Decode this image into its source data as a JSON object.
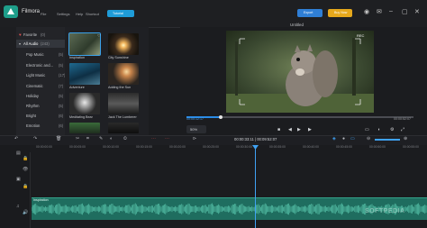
{
  "app": {
    "name": "Filmora"
  },
  "menu": [
    "File",
    "Settings",
    "Help",
    "Shortcut"
  ],
  "toolbar": {
    "tutorial": "Tutorial",
    "export": "Export",
    "buy_now": "Buy Now"
  },
  "library": {
    "items": [
      {
        "label": "Favorite",
        "count": "(0)"
      },
      {
        "label": "All Audio",
        "count": "(243)"
      },
      {
        "label": "Pop Music",
        "count": "(5)"
      },
      {
        "label": "Electronic and...",
        "count": "(5)"
      },
      {
        "label": "Light Music",
        "count": "(17)"
      },
      {
        "label": "Cinematic",
        "count": "(7)"
      },
      {
        "label": "Holiday",
        "count": "(5)"
      },
      {
        "label": "Rhythm",
        "count": "(5)"
      },
      {
        "label": "Bright",
        "count": "(6)"
      },
      {
        "label": "Emotion",
        "count": "(6)"
      }
    ],
    "selected": "All Audio"
  },
  "media": [
    {
      "label": "Inspiration"
    },
    {
      "label": "City Sunshine"
    },
    {
      "label": "Adventure"
    },
    {
      "label": "Adding the Sun"
    },
    {
      "label": "Meditating Bear"
    },
    {
      "label": "Jack The Lumberer"
    }
  ],
  "preview": {
    "title": "Untitled",
    "time_current": "00:00:12:17",
    "time_total": "00:00:52:07",
    "zoom": "50%",
    "progress": 0.15
  },
  "timeline": {
    "timecode": "00:00:33:11 | 00:09:52:07",
    "ruler": [
      "00:00:00:00",
      "00:00:05:00",
      "00:00:10:00",
      "00:00:15:00",
      "00:00:20:00",
      "00:00:25:00",
      "00:00:30:00",
      "00:00:35:00",
      "00:00:40:00",
      "00:00:45:00",
      "00:00:50:00",
      "00:00:55:00"
    ],
    "audio_clip": "Inspiration"
  },
  "watermark": "SOFTPEDIA",
  "colors": {
    "accent": "#2a8be6",
    "buy": "#e6a81c",
    "audio": "#1f6d5f"
  }
}
